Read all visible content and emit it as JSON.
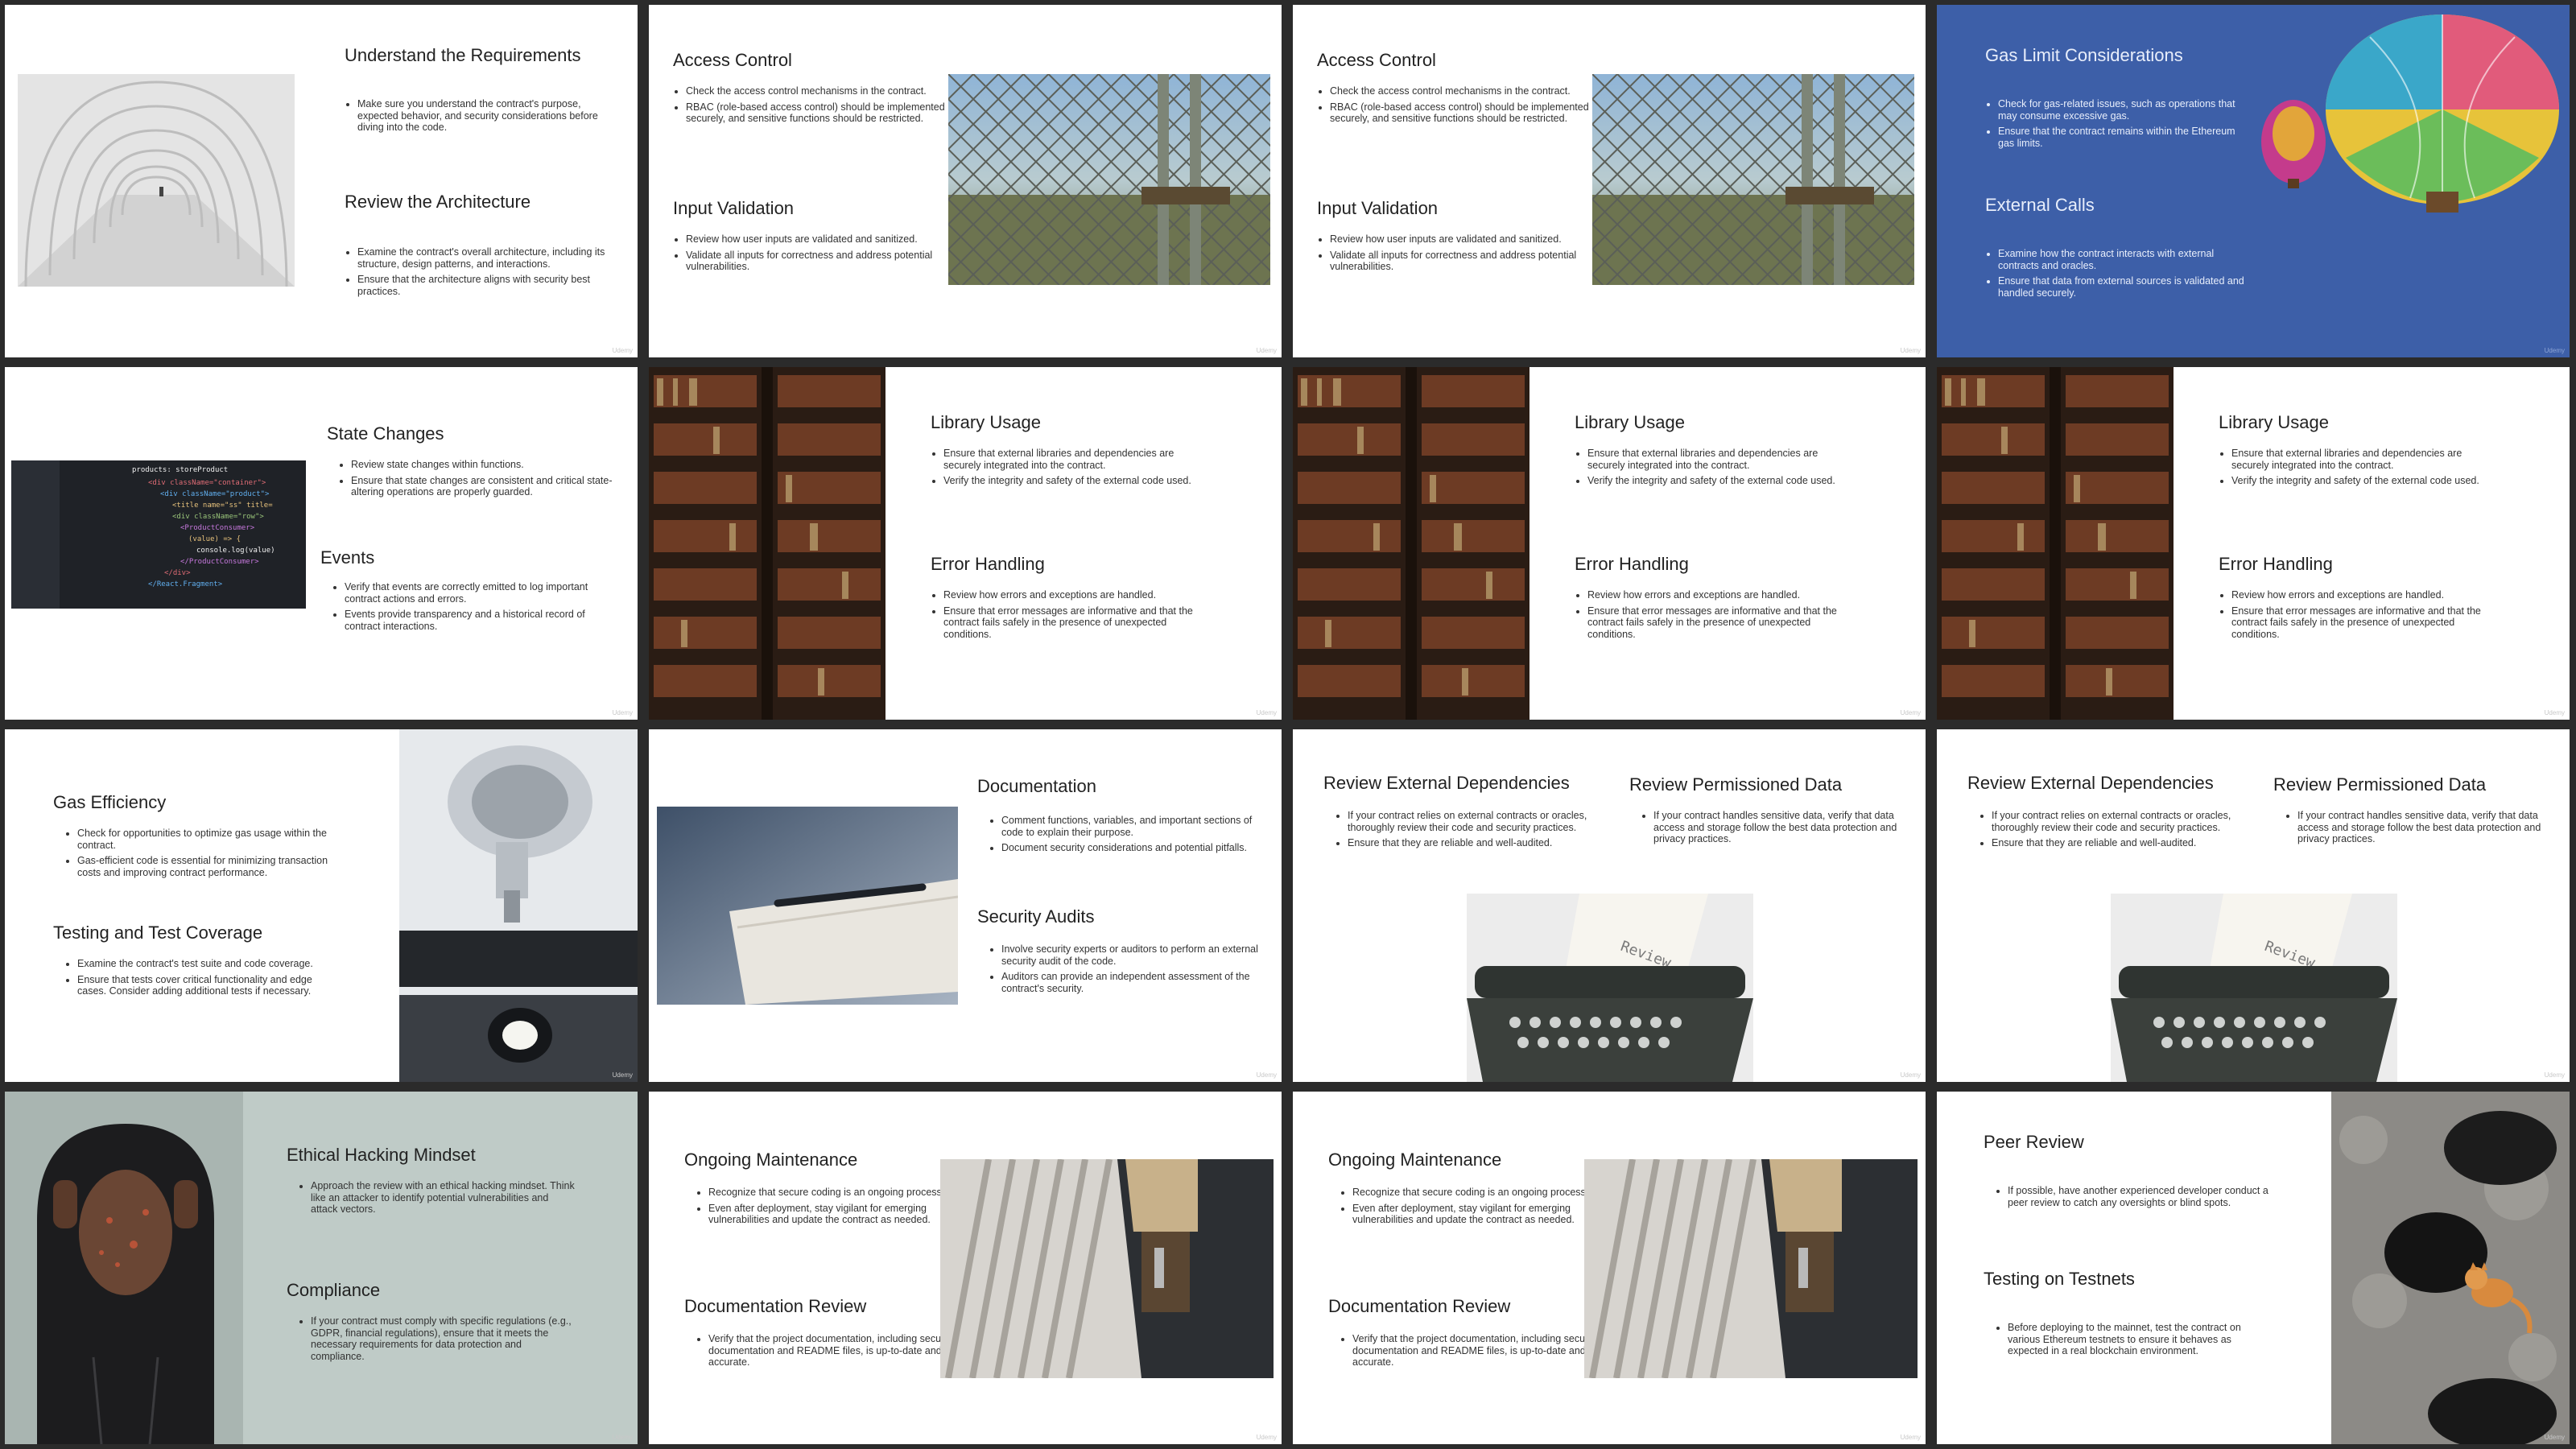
{
  "watermark": "Udemy",
  "slides": [
    {
      "s1": {
        "title": "Understand the Requirements",
        "bullets": [
          "Make sure you understand the contract's purpose, expected behavior, and security considerations before diving into the code."
        ]
      },
      "s2": {
        "title": "Review the Architecture",
        "bullets": [
          "Examine the contract's overall architecture, including its structure, design patterns, and interactions.",
          "Ensure that the architecture aligns with security best practices."
        ]
      }
    },
    {
      "s1": {
        "title": "Access Control",
        "bullets": [
          "Check the access control mechanisms in the contract.",
          "RBAC (role-based access control) should be implemented securely, and sensitive functions should be restricted."
        ]
      },
      "s2": {
        "title": "Input Validation",
        "bullets": [
          "Review how user inputs are validated and sanitized.",
          "Validate all inputs for correctness and address potential vulnerabilities."
        ]
      }
    },
    {
      "s1": {
        "title": "Access Control",
        "bullets": [
          "Check the access control mechanisms in the contract.",
          "RBAC (role-based access control) should be implemented securely, and sensitive functions should be restricted."
        ]
      },
      "s2": {
        "title": "Input Validation",
        "bullets": [
          "Review how user inputs are validated and sanitized.",
          "Validate all inputs for correctness and address potential vulnerabilities."
        ]
      }
    },
    {
      "s1": {
        "title": "Gas Limit Considerations",
        "bullets": [
          "Check for gas-related issues, such as operations that may consume excessive gas.",
          "Ensure that the contract remains within the Ethereum gas limits."
        ]
      },
      "s2": {
        "title": "External Calls",
        "bullets": [
          "Examine how the contract interacts with external contracts and oracles.",
          "Ensure that data from external sources is validated and handled securely."
        ]
      }
    },
    {
      "s1": {
        "title": "State Changes",
        "bullets": [
          "Review state changes within functions.",
          "Ensure that state changes are consistent and critical state-altering operations are properly guarded."
        ]
      },
      "s2": {
        "title": "Events",
        "bullets": [
          "Verify that events are correctly emitted to log important contract actions and errors.",
          "Events provide transparency and a historical record of contract interactions."
        ]
      }
    },
    {
      "s1": {
        "title": "Library Usage",
        "bullets": [
          "Ensure that external libraries and dependencies are securely integrated into the contract.",
          "Verify the integrity and safety of the external code used."
        ]
      },
      "s2": {
        "title": "Error Handling",
        "bullets": [
          "Review how errors and exceptions are handled.",
          "Ensure that error messages are informative and that the contract fails safely in the presence of unexpected conditions."
        ]
      }
    },
    {
      "s1": {
        "title": "Library Usage",
        "bullets": [
          "Ensure that external libraries and dependencies are securely integrated into the contract.",
          "Verify the integrity and safety of the external code used."
        ]
      },
      "s2": {
        "title": "Error Handling",
        "bullets": [
          "Review how errors and exceptions are handled.",
          "Ensure that error messages are informative and that the contract fails safely in the presence of unexpected conditions."
        ]
      }
    },
    {
      "s1": {
        "title": "Library Usage",
        "bullets": [
          "Ensure that external libraries and dependencies are securely integrated into the contract.",
          "Verify the integrity and safety of the external code used."
        ]
      },
      "s2": {
        "title": "Error Handling",
        "bullets": [
          "Review how errors and exceptions are handled.",
          "Ensure that error messages are informative and that the contract fails safely in the presence of unexpected conditions."
        ]
      }
    },
    {
      "s1": {
        "title": "Gas Efficiency",
        "bullets": [
          "Check for opportunities to optimize gas usage within the contract.",
          "Gas-efficient code is essential for minimizing transaction costs and improving contract performance."
        ]
      },
      "s2": {
        "title": "Testing and Test Coverage",
        "bullets": [
          "Examine the contract's test suite and code coverage.",
          "Ensure that tests cover critical functionality and edge cases. Consider adding additional tests if necessary."
        ]
      }
    },
    {
      "s1": {
        "title": "Documentation",
        "bullets": [
          "Comment functions, variables, and important sections of code to explain their purpose.",
          "Document security considerations and potential pitfalls."
        ]
      },
      "s2": {
        "title": "Security Audits",
        "bullets": [
          "Involve security experts or auditors to perform an external security audit of the code.",
          "Auditors can provide an independent assessment of the contract's security."
        ]
      }
    },
    {
      "s1": {
        "title": "Review External Dependencies",
        "bullets": [
          "If your contract relies on external contracts or oracles, thoroughly review their code and security practices.",
          "Ensure that they are reliable and well-audited."
        ]
      },
      "s2": {
        "title": "Review Permissioned Data",
        "bullets": [
          "If your contract handles sensitive data, verify that data access and storage follow the best data protection and privacy practices."
        ]
      },
      "paper_text": "Review"
    },
    {
      "s1": {
        "title": "Review External Dependencies",
        "bullets": [
          "If your contract relies on external contracts or oracles, thoroughly review their code and security practices.",
          "Ensure that they are reliable and well-audited."
        ]
      },
      "s2": {
        "title": "Review Permissioned Data",
        "bullets": [
          "If your contract handles sensitive data, verify that data access and storage follow the best data protection and privacy practices."
        ]
      },
      "paper_text": "Review"
    },
    {
      "s1": {
        "title": "Ethical Hacking Mindset",
        "bullets": [
          "Approach the review with an ethical hacking mindset. Think like an attacker to identify potential vulnerabilities and attack vectors."
        ]
      },
      "s2": {
        "title": "Compliance",
        "bullets": [
          "If your contract must comply with specific regulations (e.g., GDPR, financial regulations), ensure that it meets the necessary requirements for data protection and compliance."
        ]
      }
    },
    {
      "s1": {
        "title": "Ongoing Maintenance",
        "bullets": [
          "Recognize that secure coding is an ongoing process.",
          "Even after deployment, stay vigilant for emerging vulnerabilities and update the contract as needed."
        ]
      },
      "s2": {
        "title": "Documentation Review",
        "bullets": [
          "Verify that the project documentation, including security documentation and README files, is up-to-date and accurate."
        ]
      }
    },
    {
      "s1": {
        "title": "Ongoing Maintenance",
        "bullets": [
          "Recognize that secure coding is an ongoing process.",
          "Even after deployment, stay vigilant for emerging vulnerabilities and update the contract as needed."
        ]
      },
      "s2": {
        "title": "Documentation Review",
        "bullets": [
          "Verify that the project documentation, including security documentation and README files, is up-to-date and accurate."
        ]
      }
    },
    {
      "s1": {
        "title": "Peer Review",
        "bullets": [
          "If possible, have another experienced developer conduct a peer review to catch any oversights or blind spots."
        ]
      },
      "s2": {
        "title": "Testing on Testnets",
        "bullets": [
          "Before deploying to the mainnet, test the contract on various Ethereum testnets to ensure it behaves as expected in a real blockchain environment."
        ]
      }
    }
  ]
}
